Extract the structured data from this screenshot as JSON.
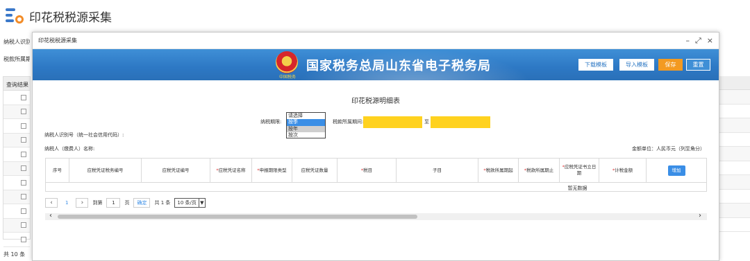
{
  "page": {
    "title": "印花税税源采集",
    "bg_label_taxid": "纳税人识别号",
    "bg_label_period": "税款所属期",
    "bg_table_header": "查询结果",
    "bg_total": "共 10 条"
  },
  "modal": {
    "title": "印花税税源采集",
    "minimize": "–",
    "maximize": "⤢",
    "close": "×"
  },
  "banner": {
    "title": "国家税务总局山东省电子税务局",
    "emblem_caption": "中国税务",
    "buttons": {
      "download": "下载模板",
      "import": "导入模板",
      "save": "保存",
      "reset": "重置"
    },
    "colors": {
      "banner": "#2d78c4",
      "save": "#f39a21"
    }
  },
  "form": {
    "title": "印花税源明细表",
    "period_label": "纳税期限:",
    "period_options": [
      "请选择",
      "按季",
      "按年",
      "按次"
    ],
    "period_selected": "按季",
    "belong_label": "税款所属期间:",
    "to_label": "至",
    "taxid_label": "纳税人识别号（统一社会信用代码）:",
    "name_label": "纳税人（缴费人）名称:",
    "unit_label": "金额单位：人民币元（列至角分）"
  },
  "table": {
    "columns": [
      {
        "label": "序号",
        "required": false
      },
      {
        "label": "应税凭证税务编号",
        "required": false
      },
      {
        "label": "应税凭证编号",
        "required": false
      },
      {
        "label": "应税凭证名称",
        "required": true
      },
      {
        "label": "申报期限类型",
        "required": true
      },
      {
        "label": "应税凭证数量",
        "required": false
      },
      {
        "label": "税目",
        "required": true
      },
      {
        "label": "子目",
        "required": false
      },
      {
        "label": "税款所属期起",
        "required": true
      },
      {
        "label": "税款所属期止",
        "required": true
      },
      {
        "label": "应税凭证书立日期",
        "required": true
      },
      {
        "label": "计税金额",
        "required": true
      }
    ],
    "add_label": "增加",
    "empty_text": "暂无数据"
  },
  "pager": {
    "prev": "‹",
    "next": "›",
    "current": "1",
    "goto_label": "到第",
    "goto_value": "1",
    "page_unit": "页",
    "ok_label": "确定",
    "total": "共 1 条",
    "page_size": "10 条/页"
  }
}
